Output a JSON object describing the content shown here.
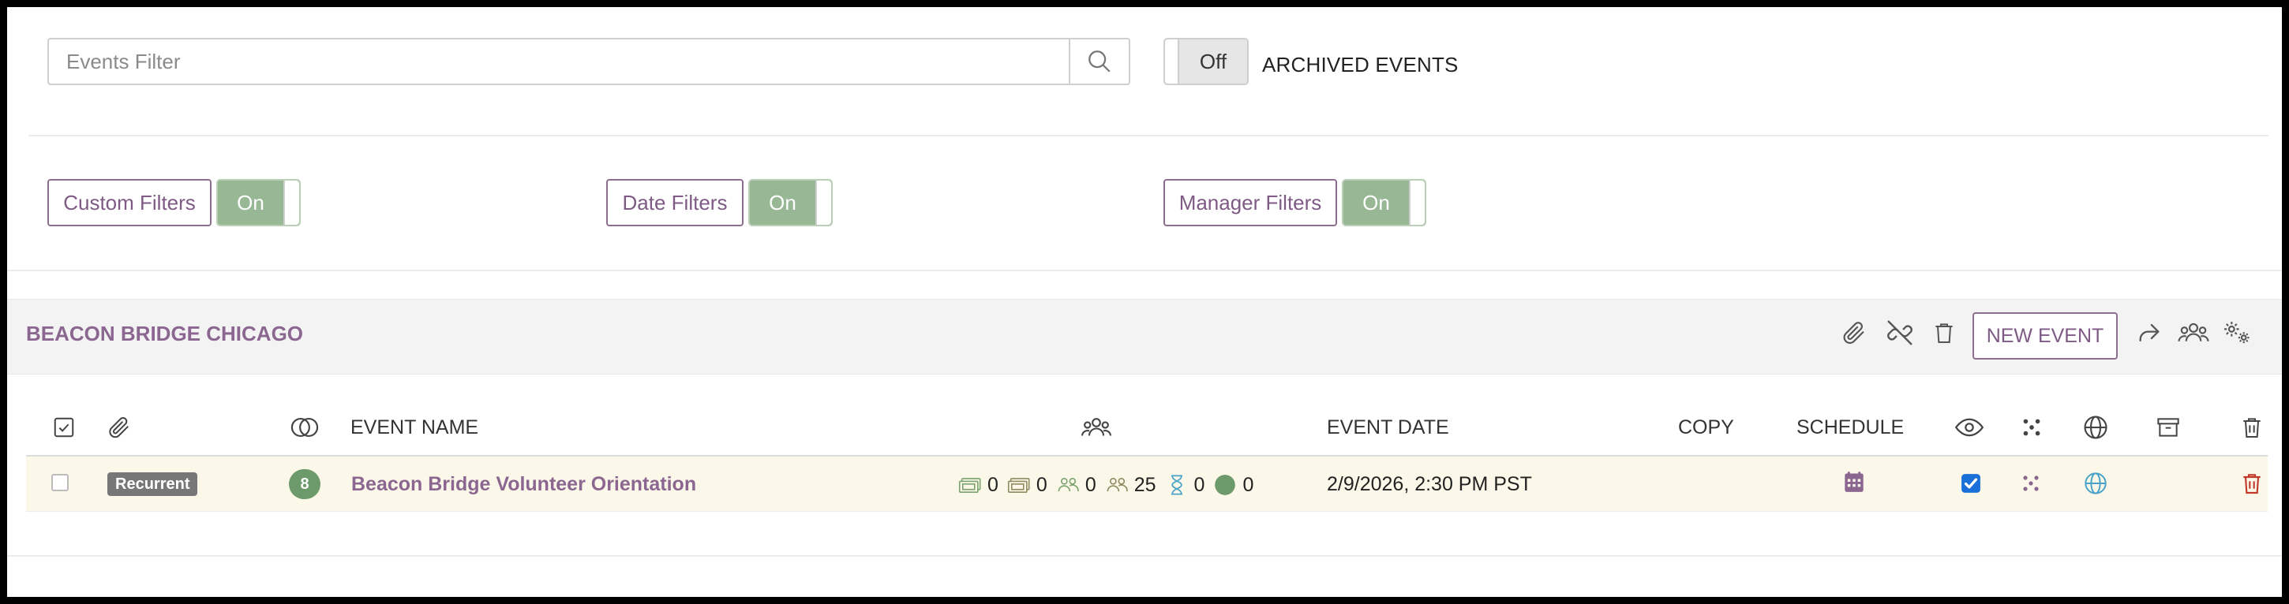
{
  "search": {
    "placeholder": "Events Filter",
    "icon": "search-icon"
  },
  "archived": {
    "toggle_label": "Off",
    "label": "ARCHIVED EVENTS"
  },
  "filters": [
    {
      "label": "Custom Filters",
      "toggle": "On"
    },
    {
      "label": "Date Filters",
      "toggle": "On"
    },
    {
      "label": "Manager Filters",
      "toggle": "On"
    }
  ],
  "group": {
    "title": "BEACON BRIDGE CHICAGO",
    "new_event_label": "NEW EVENT",
    "actions": [
      "paperclip-icon",
      "unlink-icon",
      "trash-icon",
      "share-icon",
      "users-icon",
      "settings-icon"
    ]
  },
  "table": {
    "headers": {
      "event_name": "EVENT NAME",
      "event_date": "EVENT DATE",
      "copy": "COPY",
      "schedule": "SCHEDULE"
    },
    "rows": [
      {
        "badge": "Recurrent",
        "count": "8",
        "name": "Beacon Bridge Volunteer Orientation",
        "stats": {
          "tickets": "0",
          "passes": "0",
          "attendees": "0",
          "capacity": "25",
          "waitlist": "0",
          "checked_in": "0"
        },
        "date": "2/9/2026, 2:30 PM PST",
        "visible": true
      }
    ]
  },
  "colors": {
    "accent": "#8b6690",
    "toggle_on": "#98b895",
    "count_badge": "#6c9a6b",
    "row_highlight": "#fcf8e9",
    "delete": "#c0392b",
    "globe": "#4aa3c8"
  }
}
